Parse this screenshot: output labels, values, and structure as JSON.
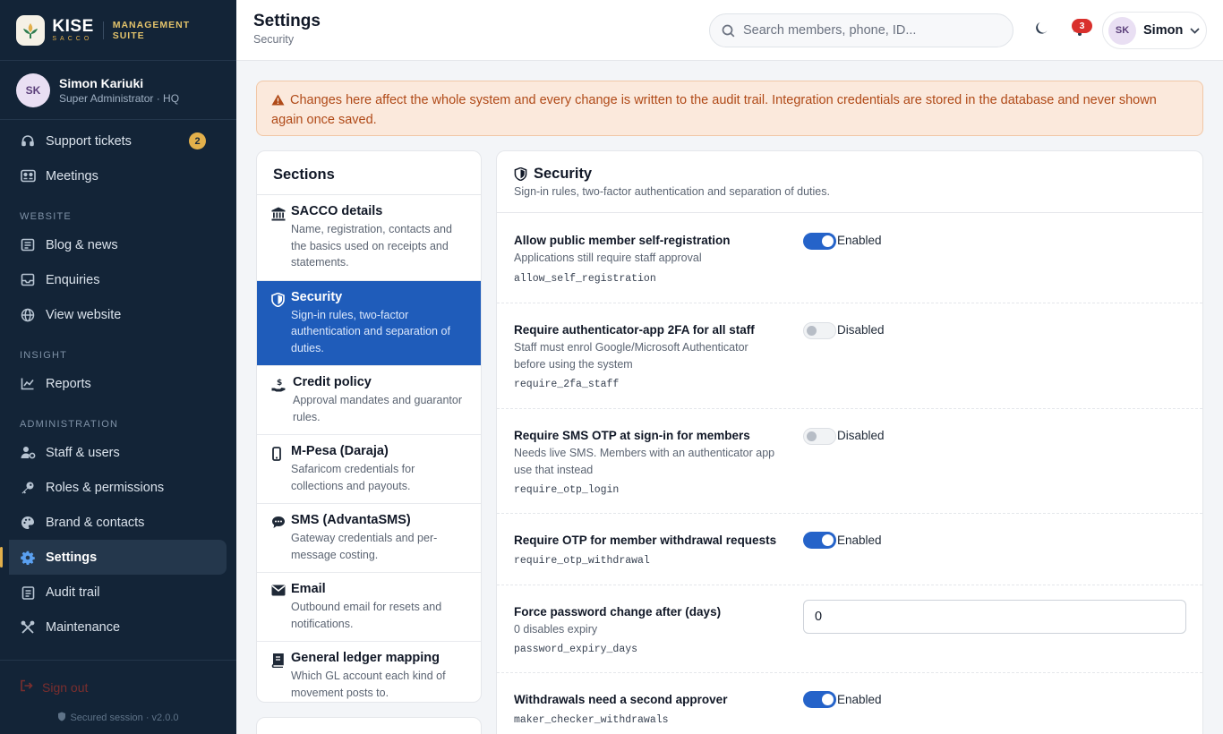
{
  "brand": {
    "name": "KISE",
    "sub": "SACCO",
    "suite": "MANAGEMENT SUITE"
  },
  "user": {
    "initials": "SK",
    "name": "Simon Kariuki",
    "role": "Super Administrator · HQ",
    "short_name": "Simon"
  },
  "nav": {
    "support": {
      "label": "Support tickets",
      "badge": "2"
    },
    "meetings": "Meetings",
    "section_website": "WEBSITE",
    "blog": "Blog & news",
    "enquiries": "Enquiries",
    "view_website": "View website",
    "section_insight": "INSIGHT",
    "reports": "Reports",
    "section_admin": "ADMINISTRATION",
    "staff": "Staff & users",
    "roles": "Roles & permissions",
    "brand_contacts": "Brand & contacts",
    "settings": "Settings",
    "audit": "Audit trail",
    "maintenance": "Maintenance",
    "signout": "Sign out",
    "secured": "Secured session · v2.0.0"
  },
  "topbar": {
    "title": "Settings",
    "subtitle": "Security",
    "search_placeholder": "Search members, phone, ID...",
    "notif_count": "3"
  },
  "alert": "Changes here affect the whole system and every change is written to the audit trail. Integration credentials are stored in the database and never shown again once saved.",
  "sections": {
    "heading": "Sections",
    "items": [
      {
        "title": "SACCO details",
        "desc": "Name, registration, contacts and the basics used on receipts and statements."
      },
      {
        "title": "Security",
        "desc": "Sign-in rules, two-factor authentication and separation of duties."
      },
      {
        "title": "Credit policy",
        "desc": "Approval mandates and guarantor rules."
      },
      {
        "title": "M-Pesa (Daraja)",
        "desc": "Safaricom credentials for collections and payouts."
      },
      {
        "title": "SMS (AdvantaSMS)",
        "desc": "Gateway credentials and per-message costing."
      },
      {
        "title": "Email",
        "desc": "Outbound email for resets and notifications."
      },
      {
        "title": "General ledger mapping",
        "desc": "Which GL account each kind of movement posts to."
      }
    ]
  },
  "panel": {
    "title": "Security",
    "subtitle": "Sign-in rules, two-factor authentication and separation of duties.",
    "rows": [
      {
        "label": "Allow public member self-registration",
        "help": "Applications still require staff approval",
        "key": "allow_self_registration",
        "state": "Enabled"
      },
      {
        "label": "Require authenticator-app 2FA for all staff",
        "help": "Staff must enrol Google/Microsoft Authenticator before using the system",
        "key": "require_2fa_staff",
        "state": "Disabled"
      },
      {
        "label": "Require SMS OTP at sign-in for members",
        "help": "Needs live SMS. Members with an authenticator app use that instead",
        "key": "require_otp_login",
        "state": "Disabled"
      },
      {
        "label": "Require OTP for member withdrawal requests",
        "help": "",
        "key": "require_otp_withdrawal",
        "state": "Enabled"
      },
      {
        "label": "Force password change after (days)",
        "help": "0 disables expiry",
        "key": "password_expiry_days",
        "value": "0"
      },
      {
        "label": "Withdrawals need a second approver",
        "help": "",
        "key": "maker_checker_withdrawals",
        "state": "Enabled"
      }
    ]
  },
  "colors": {
    "sidebar": "#132437",
    "accent": "#1f5cba",
    "gold": "#e3b04b",
    "alert_bg": "#fbe9dc",
    "alert_text": "#b04a18"
  }
}
